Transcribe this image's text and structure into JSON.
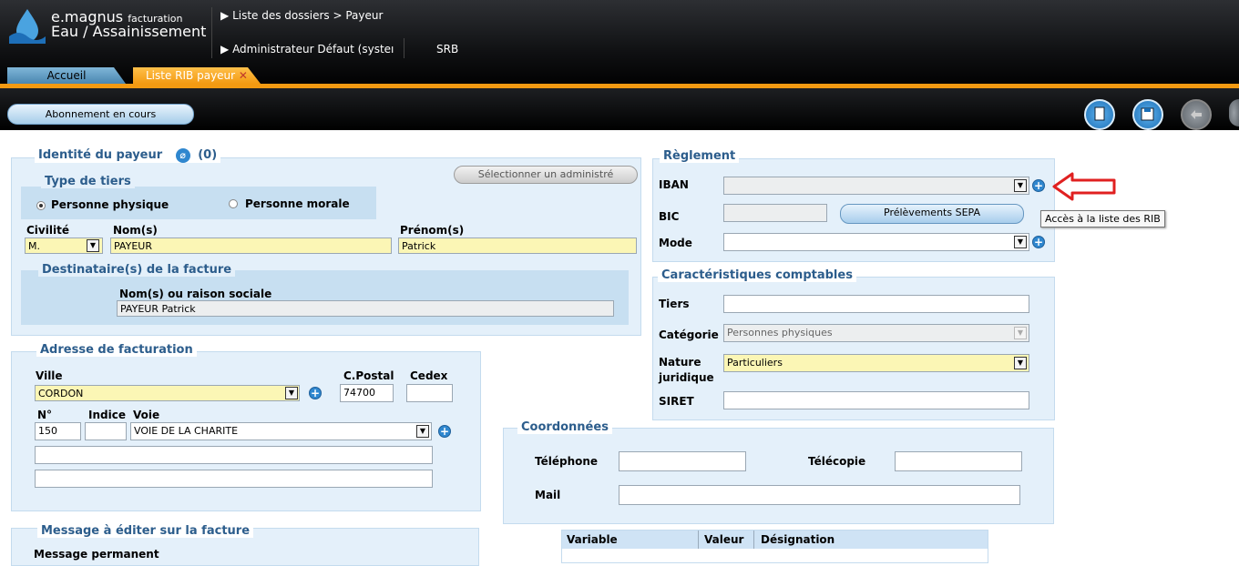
{
  "app": {
    "brand_line1": "e.magnus",
    "brand_small": "facturation",
    "brand_line2": "Eau / Assainissement",
    "breadcrumb": "Liste des dossiers > Payeur",
    "user": "Administrateur Défaut (systeı",
    "site": "SRB"
  },
  "tabs": {
    "accueil": "Accueil",
    "rib": "Liste RIB payeur",
    "rib_close": "✕"
  },
  "toolbar": {
    "abonnement": "Abonnement en cours",
    "icons": [
      "document-icon",
      "save-icon",
      "back-icon",
      "trash-icon"
    ]
  },
  "identite": {
    "legend": "Identité du payeur",
    "count": "(0)",
    "select_btn": "Sélectionner un administré",
    "type_tiers_legend": "Type de tiers",
    "personne_physique": "Personne physique",
    "personne_morale": "Personne morale",
    "civilite_label": "Civilité",
    "civilite_value": "M.",
    "noms_label": "Nom(s)",
    "noms_value": "PAYEUR",
    "prenom_label": "Prénom(s)",
    "prenom_value": "Patrick",
    "destinataire_legend": "Destinataire(s) de la facture",
    "raison_label": "Nom(s) ou raison sociale",
    "raison_value": "PAYEUR Patrick"
  },
  "adresse": {
    "legend": "Adresse de facturation",
    "ville_label": "Ville",
    "ville_value": "CORDON",
    "cp_label": "C.Postal",
    "cp_value": "74700",
    "cedex_label": "Cedex",
    "cedex_value": "",
    "num_label": "N°",
    "num_value": "150",
    "indice_label": "Indice",
    "indice_value": "",
    "voie_label": "Voie",
    "voie_value": "VOIE DE LA CHARITE",
    "line2": "",
    "line3": ""
  },
  "message": {
    "legend": "Message à éditer sur la facture",
    "permanent_label": "Message permanent"
  },
  "reglement": {
    "legend": "Règlement",
    "iban_label": "IBAN",
    "iban_value": "",
    "bic_label": "BIC",
    "bic_value": "",
    "sepa_btn": "Prélèvements SEPA",
    "mode_label": "Mode",
    "mode_value": "",
    "tooltip": "Accès à la liste des RIB"
  },
  "comptable": {
    "legend": "Caractéristiques comptables",
    "tiers_label": "Tiers",
    "tiers_value": "",
    "categorie_label": "Catégorie",
    "categorie_value": "Personnes physiques",
    "nature_label1": "Nature",
    "nature_label2": "juridique",
    "nature_value": "Particuliers",
    "siret_label": "SIRET",
    "siret_value": ""
  },
  "coordonnees": {
    "legend": "Coordonnées",
    "tel_label": "Téléphone",
    "tel_value": "",
    "fax_label": "Télécopie",
    "fax_value": "",
    "mail_label": "Mail",
    "mail_value": ""
  },
  "variables_table": {
    "headers": [
      "Variable",
      "Valeur",
      "Désignation"
    ]
  },
  "colors": {
    "accent": "#2c5d8c",
    "panel": "#e4f0fa",
    "highlight_field": "#fbf6b5",
    "arrow": "#e02020"
  }
}
